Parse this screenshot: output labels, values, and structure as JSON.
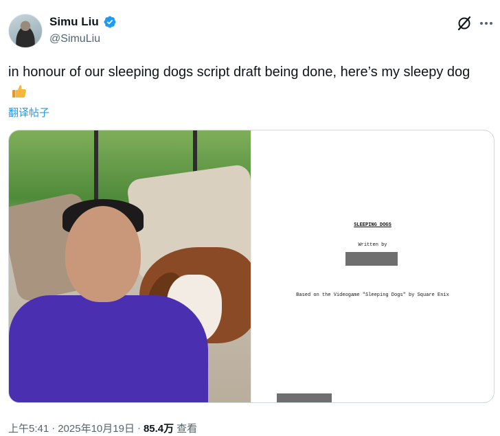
{
  "author": {
    "display_name": "Simu Liu",
    "handle": "@SimuLiu",
    "verified": true,
    "verified_color": "#1d9bf0"
  },
  "icons": {
    "grok": "grok-icon",
    "more": "more-icon",
    "thumbs_up": "thumbs-up-emoji"
  },
  "tweet": {
    "text": "in honour of our sleeping dogs script draft being done, here’s my sleepy dog",
    "translate_label": "翻译帖子"
  },
  "media": {
    "script_page": {
      "title": "SLEEPING DOGS",
      "written_by": "Written by",
      "based_on": "Based on the Videogame \"Sleeping Dogs\" by Square Enix"
    }
  },
  "meta": {
    "time": "上午5:41",
    "separator": "·",
    "date": "2025年10月19日",
    "views_count": "85.4万",
    "views_label": "查看"
  },
  "colors": {
    "accent": "#1d9bf0",
    "text": "#0f1419",
    "secondary_text": "#536471",
    "border": "#cfd9de"
  }
}
